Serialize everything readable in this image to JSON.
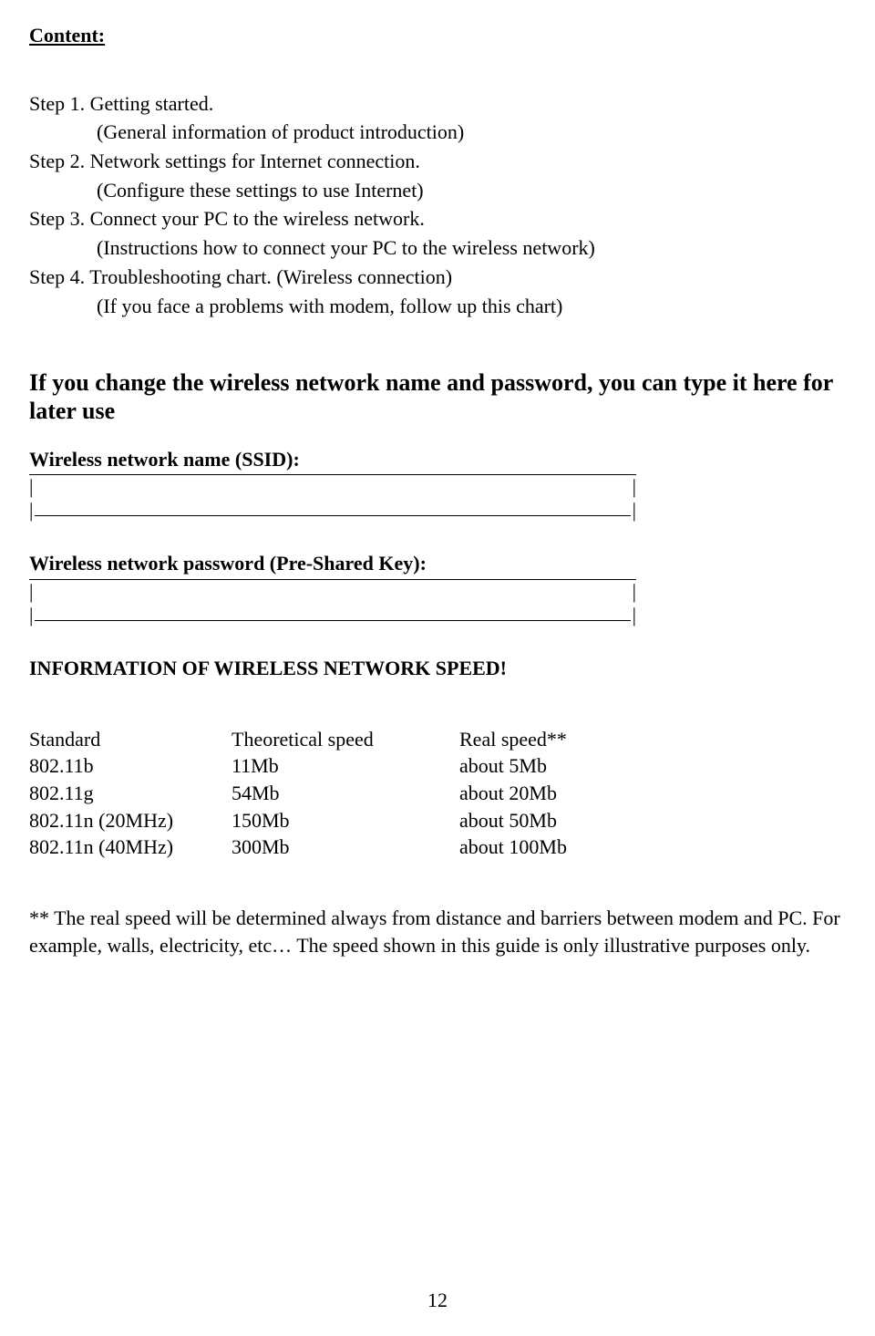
{
  "heading": "Content:",
  "steps": [
    {
      "title": "Step 1. Getting started.",
      "sub": "(General information of product introduction)"
    },
    {
      "title": "Step 2. Network settings for Internet connection.",
      "sub": "(Configure these settings to use Internet)"
    },
    {
      "title": "Step 3. Connect your PC to the wireless network.",
      "sub": "(Instructions how to connect your PC to the wireless network)"
    },
    {
      "title": "Step 4. Troubleshooting chart. (Wireless connection)",
      "sub": "(If you face a problems with modem, follow up this chart)"
    }
  ],
  "note": "If you change the wireless network name and password, you can type it here for later use",
  "ssid_label": "Wireless network name (SSID):",
  "psk_label": "Wireless network password (Pre-Shared Key):",
  "info_header": "INFORMATION OF WIRELESS NETWORK SPEED!",
  "chart_data": {
    "type": "table",
    "columns": [
      "Standard",
      "Theoretical speed",
      "Real speed**"
    ],
    "rows": [
      [
        "802.11b",
        "11Mb",
        "about 5Mb"
      ],
      [
        "802.11g",
        "54Mb",
        "about 20Mb"
      ],
      [
        "802.11n (20MHz)",
        "150Mb",
        "about 50Mb"
      ],
      [
        "802.11n (40MHz)",
        "300Mb",
        "about 100Mb"
      ]
    ]
  },
  "footnote": "** The real speed will be determined always from distance and barriers between modem and PC. For example, walls, electricity, etc… The speed shown in this guide is only illustrative purposes only.",
  "page_number": "12"
}
